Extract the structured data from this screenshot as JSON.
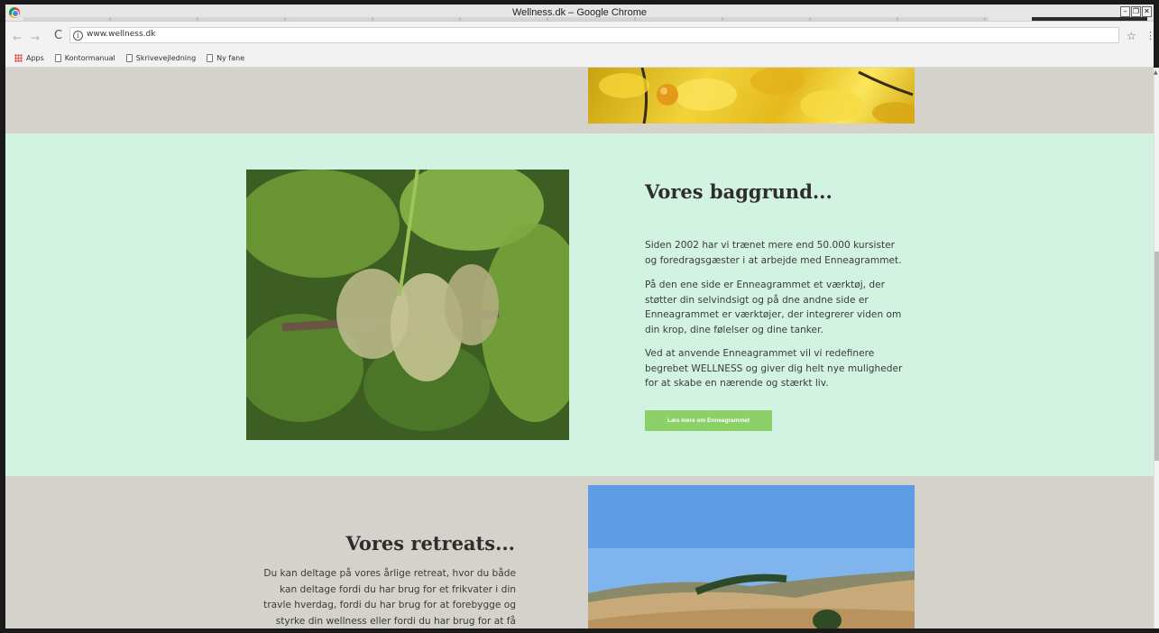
{
  "window": {
    "title": "Wellness.dk – Google Chrome",
    "controls": [
      "–",
      "❐",
      "✕"
    ]
  },
  "toolbar": {
    "url": "www.wellness.dk",
    "info_glyph": "i",
    "back_glyph": "←",
    "forward_glyph": "→",
    "reload_glyph": "C",
    "star_glyph": "☆",
    "menu_glyph": "⋮"
  },
  "bookmarks": [
    {
      "label": "Apps",
      "icon": "apps-grid-icon"
    },
    {
      "label": "Kontormanual",
      "icon": "page-icon"
    },
    {
      "label": "Skrivevejledning",
      "icon": "page-icon"
    },
    {
      "label": "Ny fane",
      "icon": "page-icon"
    }
  ],
  "background_section": {
    "heading": "Vores baggrund...",
    "paragraphs": [
      "Siden 2002 har vi trænet mere end 50.000 kursister og foredragsgæster i at arbejde med Enneagrammet.",
      "På den ene side er Enneagrammet et værktøj, der støtter din selvindsigt og på dne andne side er Enneagrammet er værktøjer, der integrerer viden om din krop, dine følelser og dine tanker.",
      "Ved at anvende Enneagrammet vil vi redefinere begrebet WELLNESS og giver dig helt nye muligheder for at skabe en nærende og stærkt liv."
    ],
    "cta_label": "Læs mere om Enneagrammet"
  },
  "retreats_section": {
    "heading": "Vores retreats...",
    "paragraph": "Du kan deltage på vores årlige retreat, hvor du både kan deltage fordi du har brug for et frikvater i din travle hverdag, fordi du har brug for at forebygge og styrke din wellness eller fordi du har brug for at få rettet op på din indre kropslige, emotionelle eller kognitive balance."
  },
  "colors": {
    "band_gray": "#d4d2cb",
    "band_mint": "#d2f3e2",
    "cta_green": "#8bd168"
  }
}
